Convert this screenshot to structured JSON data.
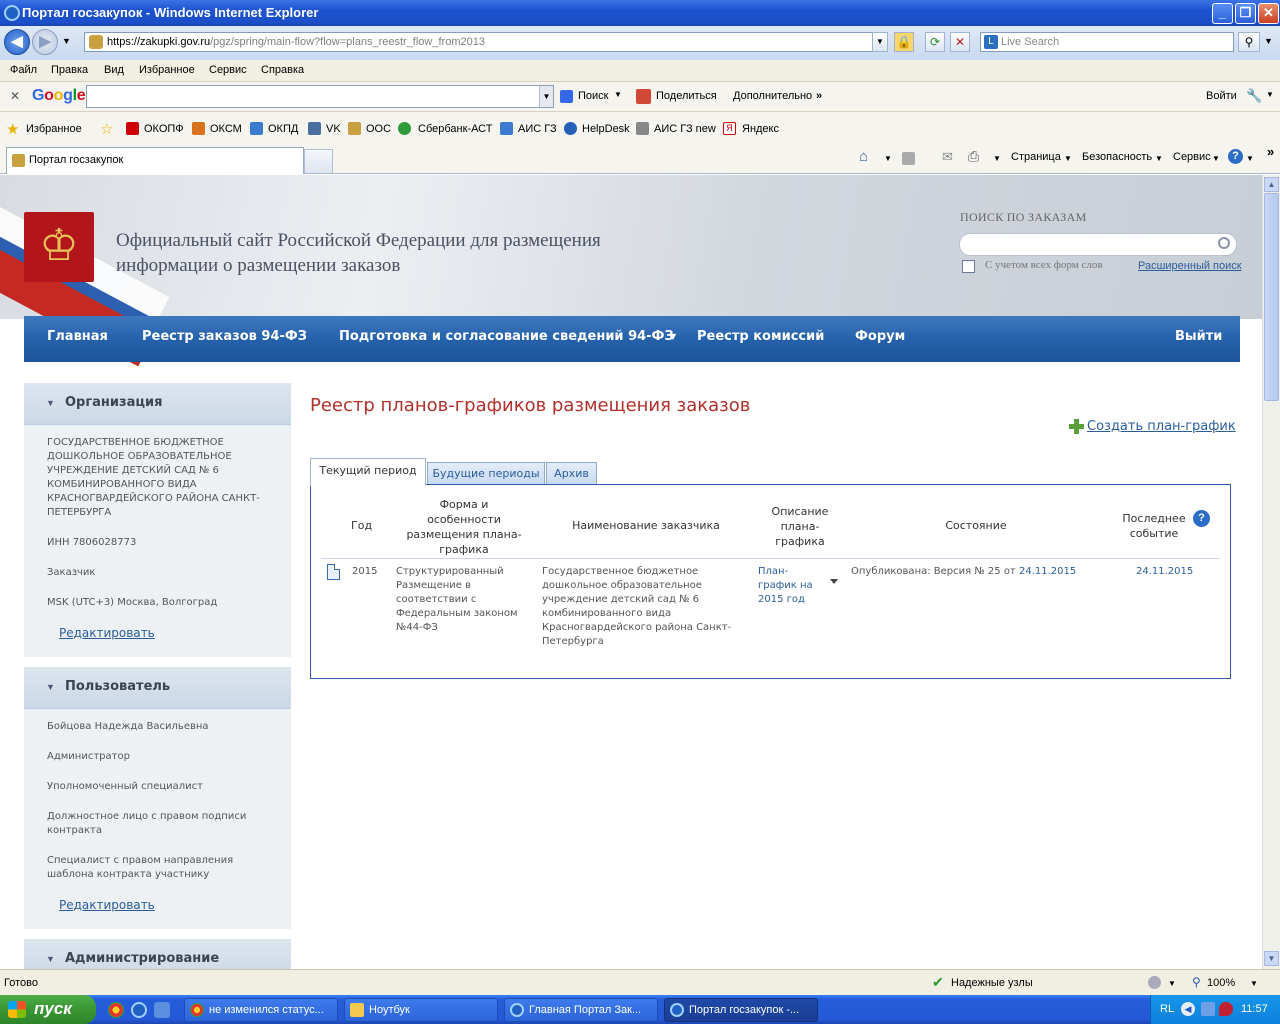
{
  "window": {
    "title": "Портал госзакупок - Windows Internet Explorer"
  },
  "address": {
    "url_host": "https://zakupki.gov.ru",
    "url_path": "/pgz/spring/main-flow?flow=plans_reestr_flow_from2013"
  },
  "live_search": {
    "placeholder": "Live Search"
  },
  "menu": [
    "Файл",
    "Правка",
    "Вид",
    "Избранное",
    "Сервис",
    "Справка"
  ],
  "google_bar": {
    "logo": "Google",
    "search": "Поиск",
    "share": "Поделиться",
    "more": "Дополнительно",
    "login": "Войти"
  },
  "favorites": [
    "Избранное",
    "ОКОПФ",
    "ОКСМ",
    "ОКПД",
    "VK",
    "ООС",
    "Сбербанк-АСТ",
    "АИС ГЗ",
    "HelpDesk",
    "АИС ГЗ new",
    "Яндекс"
  ],
  "tab": {
    "label": "Портал госзакупок"
  },
  "command_bar": [
    "Страница",
    "Безопасность",
    "Сервис"
  ],
  "site": {
    "title_line1": "Официальный сайт Российской Федерации для размещения",
    "title_line2": "информации о размещении заказов",
    "search_title": "ПОИСК ПО ЗАКАЗАМ",
    "search_checkbox": "С учетом всех форм слов",
    "advanced_search": "Расширенный поиск"
  },
  "topnav": [
    "Главная",
    "Реестр заказов 94-ФЗ",
    "Подготовка и согласование сведений 94-ФЗ",
    "Реестр комиссий",
    "Форум",
    "Выйти"
  ],
  "org_panel": {
    "title": "Организация",
    "name": "ГОСУДАРСТВЕННОЕ БЮДЖЕТНОЕ ДОШКОЛЬНОЕ ОБРАЗОВАТЕЛЬНОЕ УЧРЕЖДЕНИЕ ДЕТСКИЙ САД № 6 КОМБИНИРОВАННОГО ВИДА КРАСНОГВАРДЕЙСКОГО РАЙОНА САНКТ-ПЕТЕРБУРГА",
    "inn": "ИНН 7806028773",
    "role": "Заказчик",
    "timezone": "MSK (UTC+3) Москва, Волгоград",
    "edit": "Редактировать"
  },
  "user_panel": {
    "title": "Пользователь",
    "name": "Бойцова Надежда Васильевна",
    "roles": [
      "Администратор",
      "Уполномоченный специалист",
      "Должностное лицо с правом подписи контракта",
      "Специалист с правом направления шаблона контракта участнику"
    ],
    "edit": "Редактировать"
  },
  "admin_panel": {
    "title": "Администрирование"
  },
  "main": {
    "title": "Реестр планов-графиков размещения заказов",
    "create": "Создать план-график",
    "tabs": [
      "Текущий период",
      "Будущие периоды",
      "Архив"
    ]
  },
  "table": {
    "headers": [
      "Год",
      "Форма и особенности размещения плана-графика",
      "Наименование заказчика",
      "Описание плана-графика",
      "Состояние",
      "Последнее событие"
    ],
    "row": {
      "year": "2015",
      "form": "Структурированный Размещение в соответствии с Федеральным законом №44-ФЗ",
      "customer": "Государственное бюджетное дошкольное образовательное учреждение детский сад № 6 комбинированного вида Красногвардейского района Санкт-Петербурга",
      "description": "План-график на 2015 год",
      "status_text": "Опубликована: Версия №  25 от",
      "status_date": "24.11.2015",
      "last_event": "24.11.2015"
    }
  },
  "statusbar": {
    "left": "Готово",
    "zone": "Надежные узлы",
    "zoom": "100%"
  },
  "taskbar": {
    "start": "пуск",
    "buttons": [
      "не изменился статус...",
      "Ноутбук",
      "Главная Портал Зак...",
      "Портал госзакупок -..."
    ],
    "lang": "RL",
    "clock": "11:57"
  },
  "colors": {
    "accent_red": "#b0302a",
    "link": "#2b5d9a",
    "nav_blue": "#2662ac"
  }
}
